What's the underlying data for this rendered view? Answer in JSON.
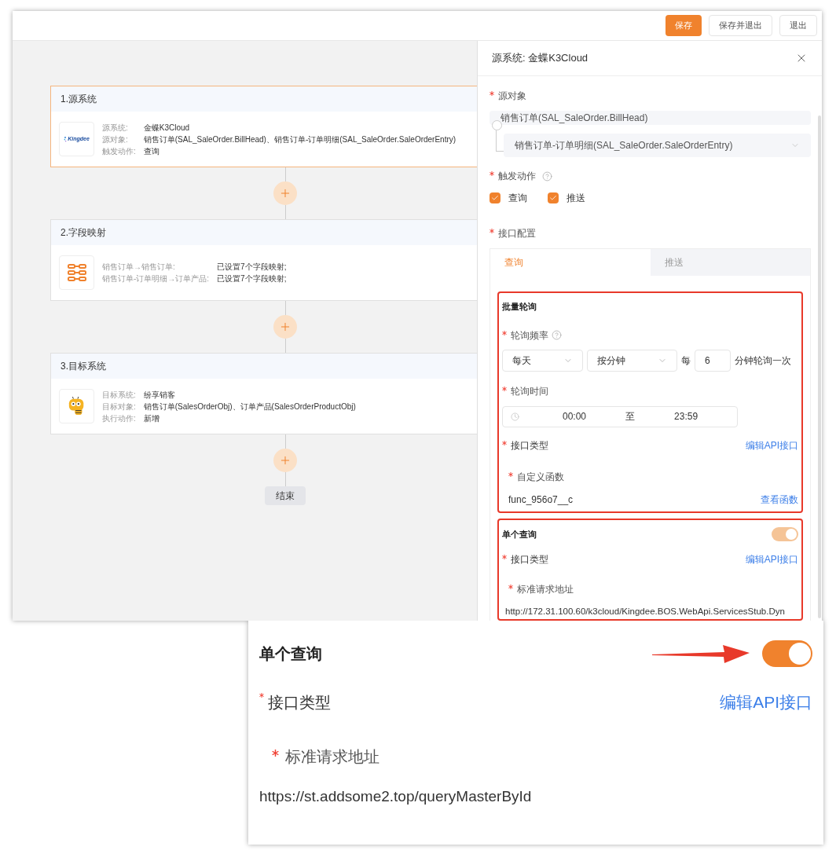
{
  "toolbar": {
    "buttons": [
      {
        "label": "保存",
        "kind": "primary"
      },
      {
        "label": "保存并退出",
        "kind": "default"
      },
      {
        "label": "退出",
        "kind": "default"
      }
    ]
  },
  "flow": {
    "cards": [
      {
        "title": "1.源系统",
        "selected": true,
        "logo": {
          "kind": "kingdee",
          "text": "Kingdee"
        },
        "fields": [
          {
            "label": "源系统:",
            "value": "金蝶K3Cloud"
          },
          {
            "label": "源对象:",
            "value": "销售订单(SAL_SaleOrder.BillHead)、销售订单-订单明细(SAL_SaleOrder.SaleOrderEntry)"
          },
          {
            "label": "触发动作:",
            "value": "查询"
          }
        ]
      },
      {
        "title": "2.字段映射",
        "selected": false,
        "logo": {
          "kind": "mapping"
        },
        "fields": [
          {
            "label": "销售订单→销售订单:",
            "value": "已设置7个字段映射;"
          },
          {
            "label": "销售订单-订单明细→订单产品:",
            "value": "已设置7个字段映射;"
          }
        ]
      },
      {
        "title": "3.目标系统",
        "selected": false,
        "logo": {
          "kind": "mascot"
        },
        "fields": [
          {
            "label": "目标系统:",
            "value": "纷享销客"
          },
          {
            "label": "目标对象:",
            "value": "销售订单(SalesOrderObj)、订单产品(SalesOrderProductObj)"
          },
          {
            "label": "执行动作:",
            "value": "新增"
          }
        ]
      }
    ],
    "end_label": "结束"
  },
  "panel": {
    "title": "源系统: 金蝶K3Cloud",
    "source_object": {
      "label": "源对象",
      "required": true,
      "value": "销售订单(SAL_SaleOrder.BillHead)",
      "child": "销售订单-订单明细(SAL_SaleOrder.SaleOrderEntry)"
    },
    "trigger": {
      "label": "触发动作",
      "required": true,
      "options": [
        {
          "label": "查询",
          "checked": true
        },
        {
          "label": "推送",
          "checked": true
        }
      ]
    },
    "api_config": {
      "label": "接口配置",
      "required": true,
      "tabs": [
        {
          "label": "查询",
          "selected": true
        },
        {
          "label": "推送",
          "selected": false
        }
      ]
    },
    "batch": {
      "title": "批量轮询",
      "highlighted": true,
      "frequency": {
        "label": "轮询频率",
        "required": true,
        "period": "每天",
        "unit": "按分钟",
        "every": "每",
        "count": "6",
        "suffix": "分钟轮询一次"
      },
      "time": {
        "label": "轮询时间",
        "required": true,
        "start": "00:00",
        "separator": "至",
        "end": "23:59"
      },
      "api_type": {
        "label": "接口类型",
        "required": true,
        "link": "编辑API接口"
      },
      "function": {
        "label": "自定义函数",
        "required": true,
        "value": "func_956o7__c",
        "link": "查看函数"
      }
    },
    "single": {
      "title": "单个查询",
      "highlighted": true,
      "on": true,
      "api_type": {
        "label": "接口类型",
        "required": true,
        "link": "编辑API接口"
      },
      "url": {
        "label": "标准请求地址",
        "required": true,
        "value": "http://172.31.100.60/k3cloud/Kingdee.BOS.WebApi.ServicesStub.Dyn"
      }
    }
  },
  "callout": {
    "title": "单个查询",
    "on": true,
    "api_type": {
      "label": "接口类型",
      "required": true,
      "link": "编辑API接口"
    },
    "url": {
      "label": "标准请求地址",
      "required": true,
      "value": "https://st.addsome2.top/queryMasterById"
    }
  }
}
